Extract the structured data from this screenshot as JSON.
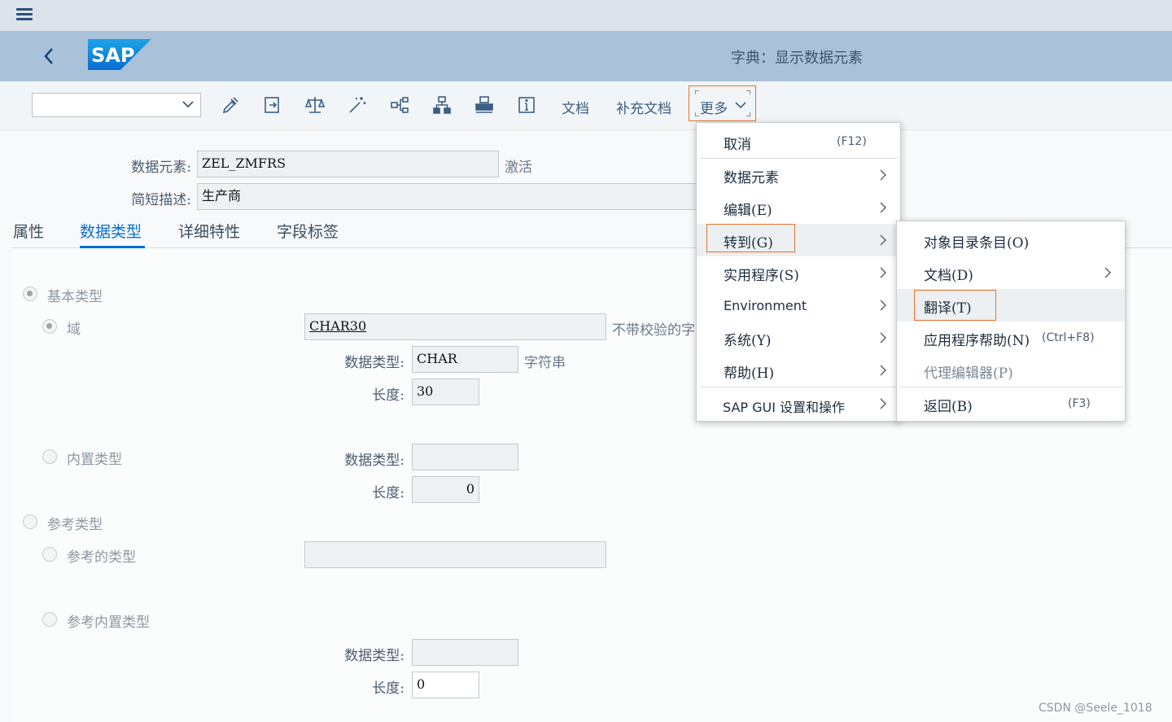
{
  "shell": {
    "menu_icon": "hamburger-icon"
  },
  "header": {
    "title": "字典：显示数据元素",
    "back_icon": "chevron-left-icon",
    "logo": "SAP"
  },
  "toolbar": {
    "command_field_value": "",
    "icons": [
      "glasses-pencil-icon",
      "switch-icon",
      "balance-icon",
      "magic-wand-icon",
      "hierarchy-icon",
      "org-chart-icon",
      "print-icon",
      "info-icon"
    ],
    "doc_label": "文档",
    "supp_doc_label": "补充文档",
    "more_label": "更多"
  },
  "form": {
    "data_element_label": "数据元素:",
    "data_element_value": "ZEL_ZMFRS",
    "status": "激活",
    "short_desc_label": "简短描述:",
    "short_desc_value": "生产商"
  },
  "tabs": [
    {
      "label": "属性"
    },
    {
      "label": "数据类型",
      "active": true
    },
    {
      "label": "详细特性"
    },
    {
      "label": "字段标签"
    }
  ],
  "datatype": {
    "basic_type": "基本类型",
    "domain": "域",
    "domain_value": "CHAR30",
    "domain_desc": "不带校验的字",
    "datatype_label": "数据类型:",
    "datatype_value": "CHAR",
    "datatype_desc": "字符串",
    "length_label": "长度:",
    "length_value": "30",
    "builtin_type": "内置类型",
    "builtin_datatype_label": "数据类型:",
    "builtin_datatype_value": "",
    "builtin_length_label": "长度:",
    "builtin_length_value": "0",
    "ref_type": "参考类型",
    "ref_type_of": "参考的类型",
    "ref_type_value": "",
    "ref_builtin": "参考内置类型",
    "ref_datatype_label": "数据类型:",
    "ref_datatype_value": "",
    "ref_length_label": "长度:",
    "ref_length_value": "0"
  },
  "menu": {
    "items": [
      {
        "label": "取消",
        "shortcut": "(F12)"
      },
      {
        "label": "数据元素"
      },
      {
        "label": "编辑(E)"
      },
      {
        "label": "转到(G)"
      },
      {
        "label": "实用程序(S)"
      },
      {
        "label": "Environment"
      },
      {
        "label": "系统(Y)"
      },
      {
        "label": "帮助(H)"
      },
      {
        "label": "SAP GUI 设置和操作"
      }
    ]
  },
  "submenu": {
    "items": [
      {
        "label": "对象目录条目(O)"
      },
      {
        "label": "文档(D)"
      },
      {
        "label": "翻译(T)"
      },
      {
        "label": "应用程序帮助(N)",
        "shortcut": "(Ctrl+F8)"
      },
      {
        "label": "代理编辑器(P)"
      },
      {
        "label": "返回(B)",
        "shortcut": "(F3)"
      }
    ]
  },
  "watermark": "CSDN @Seele_1018",
  "colors": {
    "accent": "#0a6ed1",
    "highlight_border": "#e8712a",
    "header_bg": "#a9c2da"
  }
}
